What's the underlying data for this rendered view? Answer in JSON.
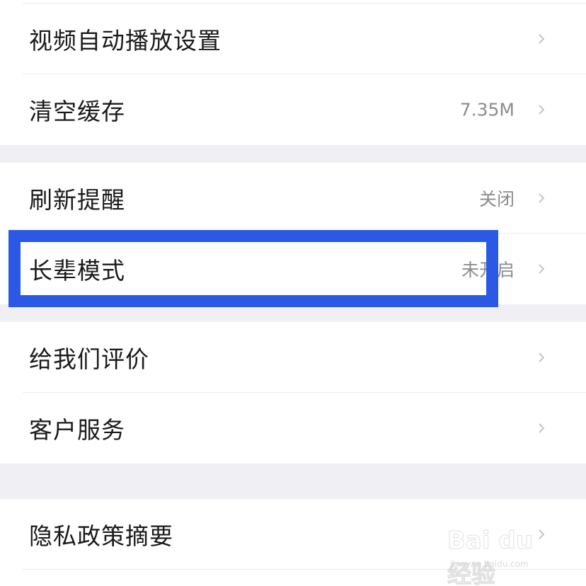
{
  "settings": {
    "items": [
      {
        "label": "视频自动播放设置",
        "value": ""
      },
      {
        "label": "清空缓存",
        "value": "7.35M"
      },
      {
        "label": "刷新提醒",
        "value": "关闭"
      },
      {
        "label": "长辈模式",
        "value": "未开启"
      },
      {
        "label": "给我们评价",
        "value": ""
      },
      {
        "label": "客户服务",
        "value": ""
      },
      {
        "label": "隐私政策摘要",
        "value": ""
      }
    ]
  },
  "highlight": {
    "color": "#2a59e6"
  },
  "watermark": {
    "main": "Bai du 经验",
    "sub": "jingyan.baidu.com"
  },
  "icons": {
    "chevron": "chevron-right-icon"
  }
}
